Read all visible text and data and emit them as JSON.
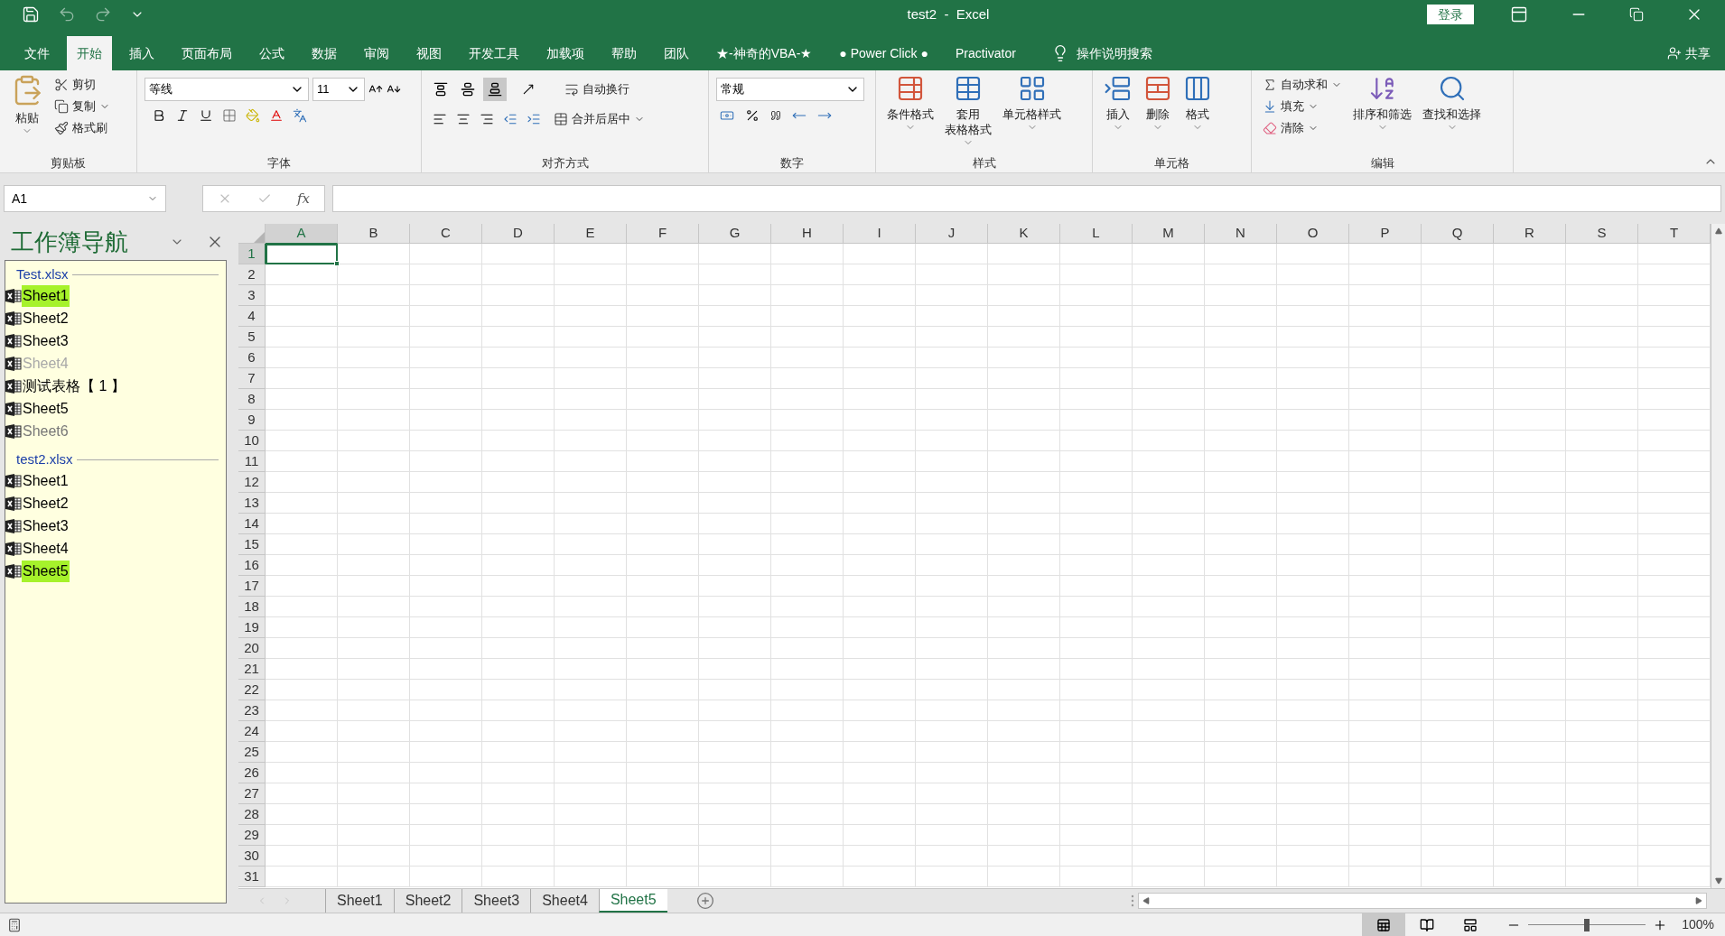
{
  "title_bar": {
    "title": "test2  -  Excel",
    "login": "登录"
  },
  "ribbon_tabs": [
    {
      "label": "文件",
      "selected": false
    },
    {
      "label": "开始",
      "selected": true
    },
    {
      "label": "插入",
      "selected": false
    },
    {
      "label": "页面布局",
      "selected": false
    },
    {
      "label": "公式",
      "selected": false
    },
    {
      "label": "数据",
      "selected": false
    },
    {
      "label": "审阅",
      "selected": false
    },
    {
      "label": "视图",
      "selected": false
    },
    {
      "label": "开发工具",
      "selected": false
    },
    {
      "label": "加载项",
      "selected": false
    },
    {
      "label": "帮助",
      "selected": false
    },
    {
      "label": "团队",
      "selected": false
    },
    {
      "label": "★-神奇的VBA-★",
      "selected": false
    },
    {
      "label": "● Power Click ●",
      "selected": false
    },
    {
      "label": "Practivator",
      "selected": false
    }
  ],
  "tell_me": "操作说明搜索",
  "share": "共享",
  "ribbon": {
    "clipboard": {
      "label": "剪贴板",
      "paste": "粘贴",
      "cut": "剪切",
      "copy": "复制",
      "format_painter": "格式刷"
    },
    "font": {
      "label": "字体",
      "font_name": "等线",
      "font_size": "11"
    },
    "alignment": {
      "label": "对齐方式",
      "vertical": [
        {
          "selected": false
        },
        {
          "selected": false
        },
        {
          "selected": true
        }
      ],
      "wrap_text": "自动换行",
      "merge_center": "合并后居中"
    },
    "number": {
      "label": "数字",
      "format": "常规"
    },
    "styles": {
      "label": "样式",
      "conditional": "条件格式",
      "table_format": [
        "套用",
        "表格格式"
      ],
      "cell_styles": "单元格样式"
    },
    "cells": {
      "label": "单元格",
      "insert": "插入",
      "delete": "删除",
      "format": "格式"
    },
    "editing": {
      "label": "编辑",
      "autosum": "自动求和",
      "fill": "填充",
      "clear": "清除",
      "sort_filter": "排序和筛选",
      "find_select": "查找和选择"
    }
  },
  "formula_bar": {
    "name_box": "A1",
    "fx": "fx"
  },
  "navigator": {
    "title": "工作簿导航",
    "workbooks": [
      {
        "name": "Test.xlsx",
        "sheets": [
          {
            "name": "Sheet1",
            "selected": true,
            "kind": "visible"
          },
          {
            "name": "Sheet2",
            "selected": false,
            "kind": "visible"
          },
          {
            "name": "Sheet3",
            "selected": false,
            "kind": "visible"
          },
          {
            "name": "Sheet4",
            "selected": false,
            "kind": "hidden"
          },
          {
            "name": "测试表格【 1 】",
            "selected": false,
            "kind": "visible"
          },
          {
            "name": "Sheet5",
            "selected": false,
            "kind": "visible"
          },
          {
            "name": "Sheet6",
            "selected": false,
            "kind": "veryhidden"
          }
        ]
      },
      {
        "name": "test2.xlsx",
        "sheets": [
          {
            "name": "Sheet1",
            "selected": false,
            "kind": "visible"
          },
          {
            "name": "Sheet2",
            "selected": false,
            "kind": "visible"
          },
          {
            "name": "Sheet3",
            "selected": false,
            "kind": "visible"
          },
          {
            "name": "Sheet4",
            "selected": false,
            "kind": "visible"
          },
          {
            "name": "Sheet5",
            "selected": true,
            "kind": "visible"
          }
        ]
      }
    ]
  },
  "grid": {
    "columns": [
      {
        "label": "A",
        "selected": true
      },
      {
        "label": "B",
        "selected": false
      },
      {
        "label": "C",
        "selected": false
      },
      {
        "label": "D",
        "selected": false
      },
      {
        "label": "E",
        "selected": false
      },
      {
        "label": "F",
        "selected": false
      },
      {
        "label": "G",
        "selected": false
      },
      {
        "label": "H",
        "selected": false
      },
      {
        "label": "I",
        "selected": false
      },
      {
        "label": "J",
        "selected": false
      },
      {
        "label": "K",
        "selected": false
      },
      {
        "label": "L",
        "selected": false
      },
      {
        "label": "M",
        "selected": false
      },
      {
        "label": "N",
        "selected": false
      },
      {
        "label": "O",
        "selected": false
      },
      {
        "label": "P",
        "selected": false
      },
      {
        "label": "Q",
        "selected": false
      },
      {
        "label": "R",
        "selected": false
      },
      {
        "label": "S",
        "selected": false
      },
      {
        "label": "T",
        "selected": false
      }
    ],
    "rows": [
      {
        "label": "1",
        "selected": true
      },
      {
        "label": "2",
        "selected": false
      },
      {
        "label": "3",
        "selected": false
      },
      {
        "label": "4",
        "selected": false
      },
      {
        "label": "5",
        "selected": false
      },
      {
        "label": "6",
        "selected": false
      },
      {
        "label": "7",
        "selected": false
      },
      {
        "label": "8",
        "selected": false
      },
      {
        "label": "9",
        "selected": false
      },
      {
        "label": "10",
        "selected": false
      },
      {
        "label": "11",
        "selected": false
      },
      {
        "label": "12",
        "selected": false
      },
      {
        "label": "13",
        "selected": false
      },
      {
        "label": "14",
        "selected": false
      },
      {
        "label": "15",
        "selected": false
      },
      {
        "label": "16",
        "selected": false
      },
      {
        "label": "17",
        "selected": false
      },
      {
        "label": "18",
        "selected": false
      },
      {
        "label": "19",
        "selected": false
      },
      {
        "label": "20",
        "selected": false
      },
      {
        "label": "21",
        "selected": false
      },
      {
        "label": "22",
        "selected": false
      },
      {
        "label": "23",
        "selected": false
      },
      {
        "label": "24",
        "selected": false
      },
      {
        "label": "25",
        "selected": false
      },
      {
        "label": "26",
        "selected": false
      },
      {
        "label": "27",
        "selected": false
      },
      {
        "label": "28",
        "selected": false
      },
      {
        "label": "29",
        "selected": false
      },
      {
        "label": "30",
        "selected": false
      },
      {
        "label": "31",
        "selected": false
      }
    ]
  },
  "sheet_tabs": [
    {
      "label": "Sheet1",
      "selected": false
    },
    {
      "label": "Sheet2",
      "selected": false
    },
    {
      "label": "Sheet3",
      "selected": false
    },
    {
      "label": "Sheet4",
      "selected": false
    },
    {
      "label": "Sheet5",
      "selected": true
    }
  ],
  "status_bar": {
    "views": [
      {
        "selected": true
      },
      {
        "selected": false
      },
      {
        "selected": false
      }
    ],
    "zoom": {
      "level": 0.5,
      "reading": "100%"
    }
  }
}
